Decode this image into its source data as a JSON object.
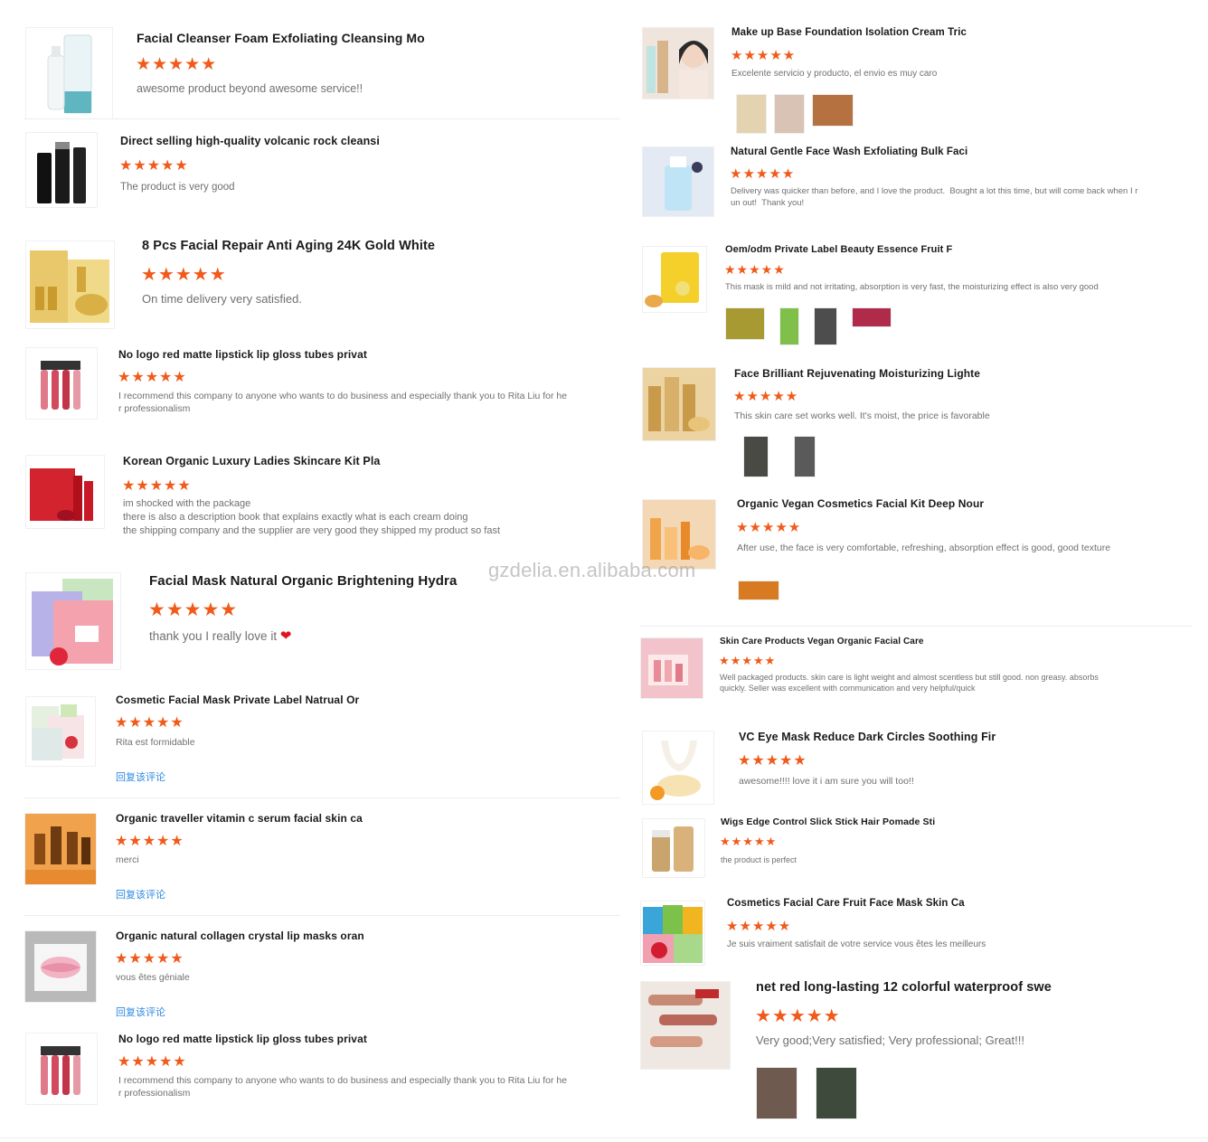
{
  "watermark": "gzdelia.en.alibaba.com",
  "stars": "★★★★★",
  "reply_label": "回复该评论",
  "colors": {
    "accent": "#f05a1a",
    "link": "#2f8ae0",
    "heart": "#e0141e"
  },
  "left": [
    {
      "title": "Facial Cleanser Foam Exfoliating Cleansing Mo",
      "comment": "awesome product beyond awesome service!!"
    },
    {
      "title": "Direct selling high-quality volcanic rock cleansi",
      "comment": "The product is very good"
    },
    {
      "title": "8 Pcs Facial Repair Anti Aging 24K Gold White",
      "comment": "On time delivery very satisfied."
    },
    {
      "title": "No logo red matte lipstick lip gloss tubes privat",
      "comment": "I recommend this company to anyone who wants to do business and especially thank you to Rita Liu for he\nr professionalism"
    },
    {
      "title": "Korean Organic Luxury Ladies Skincare Kit Pla",
      "comment": "im shocked with the package\nthere is also a description book that explains exactly what is each cream doing\nthe shipping company and the supplier are very good they shipped my product so fast"
    },
    {
      "title": "Facial Mask Natural Organic Brightening Hydra",
      "comment": "thank you I really love it"
    },
    {
      "title": "Cosmetic Facial Mask Private Label Natrual Or",
      "comment": "Rita est formidable"
    },
    {
      "title": "Organic traveller vitamin c serum facial skin ca",
      "comment": "merci"
    },
    {
      "title": "Organic natural collagen crystal lip masks oran",
      "comment": "vous êtes géniale"
    },
    {
      "title": "No logo red matte lipstick lip gloss tubes privat",
      "comment": "I recommend this company to anyone who wants to do business and especially thank you to Rita Liu for he\nr professionalism"
    }
  ],
  "right": [
    {
      "title": "Make up Base Foundation Isolation Cream Tric",
      "comment": "Excelente servicio y producto, el envio es muy caro"
    },
    {
      "title": "Natural Gentle Face Wash Exfoliating Bulk Faci",
      "comment": "Delivery was quicker than before, and I love the product.  Bought a lot this time, but will come back when I r\nun out!  Thank you!"
    },
    {
      "title": "Oem/odm Private Label Beauty Essence Fruit F",
      "comment": "This mask is mild and not irritating, absorption is very fast, the moisturizing effect is also very good"
    },
    {
      "title": "Face Brilliant Rejuvenating Moisturizing Lighte",
      "comment": "This skin care set works well. It's moist, the price is favorable"
    },
    {
      "title": "Organic Vegan Cosmetics Facial Kit Deep Nour",
      "comment": "After use, the face is very comfortable, refreshing, absorption effect is good, good texture"
    },
    {
      "title": "Skin Care Products Vegan Organic Facial Care",
      "comment": "Well packaged products. skin care is light weight and almost scentless but still good. non greasy. absorbs\nquickly. Seller was excellent with communication and very helpful/quick"
    },
    {
      "title": "VC Eye Mask Reduce Dark Circles Soothing Fir",
      "comment": "awesome!!!! love it i am sure you will too!!"
    },
    {
      "title": "Wigs Edge Control Slick Stick Hair Pomade Sti",
      "comment": "the product is perfect"
    },
    {
      "title": "Cosmetics Facial Care Fruit Face Mask Skin Ca",
      "comment": "Je suis vraiment satisfait de votre service vous êtes les meilleurs"
    },
    {
      "title": "net red long-lasting 12 colorful waterproof swe",
      "comment": "Very good;Very satisfied; Very professional; Great!!!"
    }
  ]
}
